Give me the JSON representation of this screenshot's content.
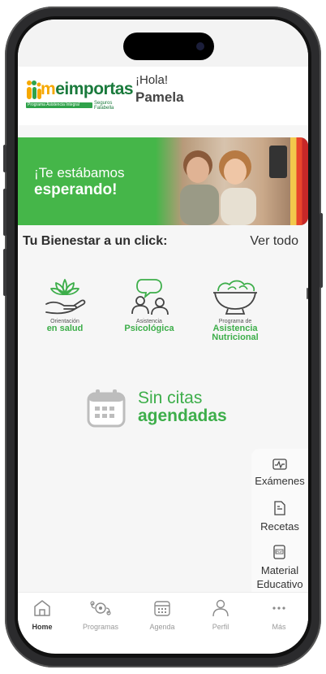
{
  "logo": {
    "brand": "Meimportas",
    "tagline": "Programa Asistencia Integral",
    "partner": "Seguros Falabella"
  },
  "greeting": {
    "hello": "¡Hola!",
    "name": "Pamela"
  },
  "banner": {
    "line1": "¡Te estábamos",
    "line2": "esperando!"
  },
  "wellness": {
    "title": "Tu Bienestar a un click:",
    "see_all": "Ver todo",
    "services": [
      {
        "caption": "Orientación",
        "label": "en salud",
        "icon": "lotus-hand-icon"
      },
      {
        "caption": "Asistencia",
        "label": "Psicológica",
        "icon": "people-chat-icon"
      },
      {
        "caption": "Programa de",
        "label": "Asistencia Nutricional",
        "label1": "Asistencia",
        "label2": "Nutricional",
        "icon": "salad-bowl-icon"
      }
    ]
  },
  "appointments": {
    "empty_line1": "Sin citas",
    "empty_line2": "agendadas",
    "icon": "calendar-icon"
  },
  "quick_menu": [
    {
      "label": "Exámenes",
      "icon": "chart-doc-icon"
    },
    {
      "label": "Recetas",
      "icon": "prescription-icon"
    },
    {
      "label": "Material Educativo",
      "label1": "Material",
      "label2": "Educativo",
      "icon": "pdf-icon"
    }
  ],
  "tabs": [
    {
      "label": "Home",
      "icon": "home-icon",
      "active": true
    },
    {
      "label": "Programas",
      "icon": "programs-icon",
      "active": false
    },
    {
      "label": "Agenda",
      "icon": "calendar-icon",
      "active": false
    },
    {
      "label": "Perfil",
      "icon": "user-icon",
      "active": false
    },
    {
      "label": "Más",
      "icon": "more-icon",
      "active": false
    }
  ],
  "colors": {
    "brand_green": "#3dae4a",
    "accent_yellow": "#f6a800"
  }
}
